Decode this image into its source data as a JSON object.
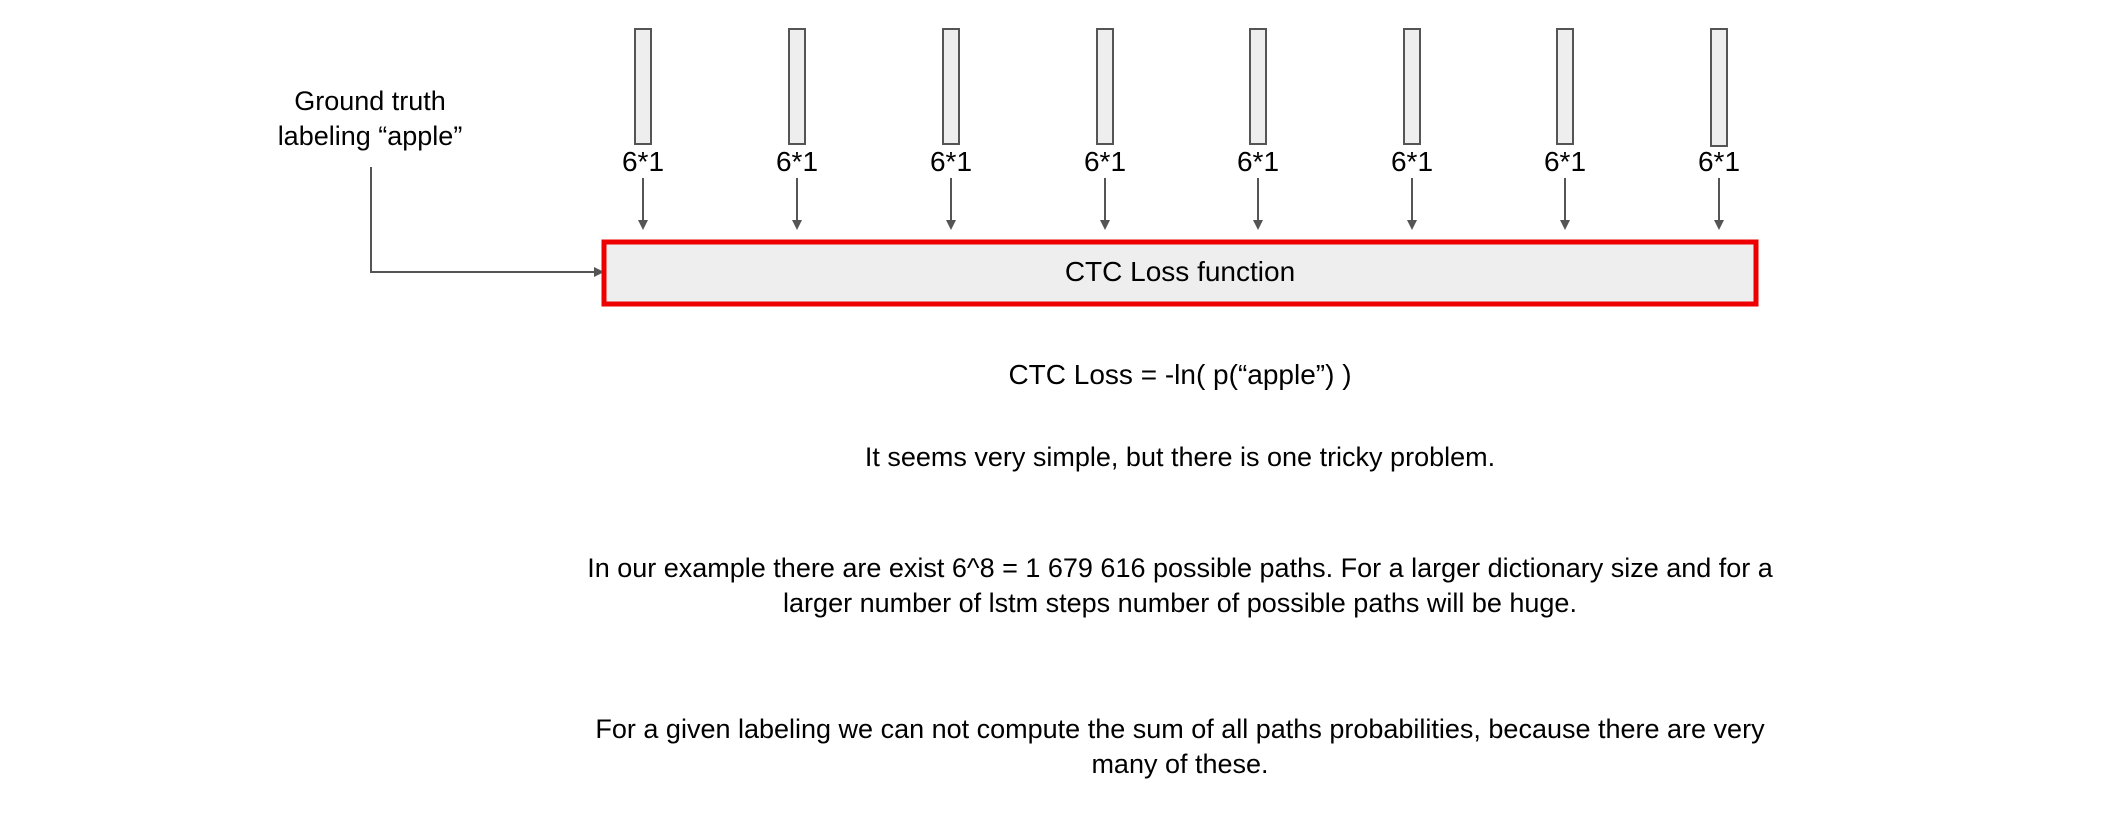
{
  "ground_truth": {
    "line1": "Ground truth",
    "line2": "labeling “apple”"
  },
  "columns": [
    {
      "label": "6*1"
    },
    {
      "label": "6*1"
    },
    {
      "label": "6*1"
    },
    {
      "label": "6*1"
    },
    {
      "label": "6*1"
    },
    {
      "label": "6*1"
    },
    {
      "label": "6*1"
    },
    {
      "label": "6*1"
    }
  ],
  "loss_box": {
    "label": "CTC Loss function",
    "border_color": "#ee0000",
    "fill_color": "#eeeeee"
  },
  "formula": "CTC Loss = -ln( p(“apple”) )",
  "paragraphs": {
    "p1": "It seems very simple, but there is one tricky problem.",
    "p2": "In our example there are exist 6^8 = 1 679 616 possible paths. For a larger dictionary size and for a larger number of lstm steps number of possible paths will be huge.",
    "p3": "For a given labeling we can not compute the sum of all paths probabilities, because there are very many of these."
  },
  "colors": {
    "arrow": "#555555",
    "vector_fill": "#eeeeee",
    "vector_stroke": "#555555"
  }
}
